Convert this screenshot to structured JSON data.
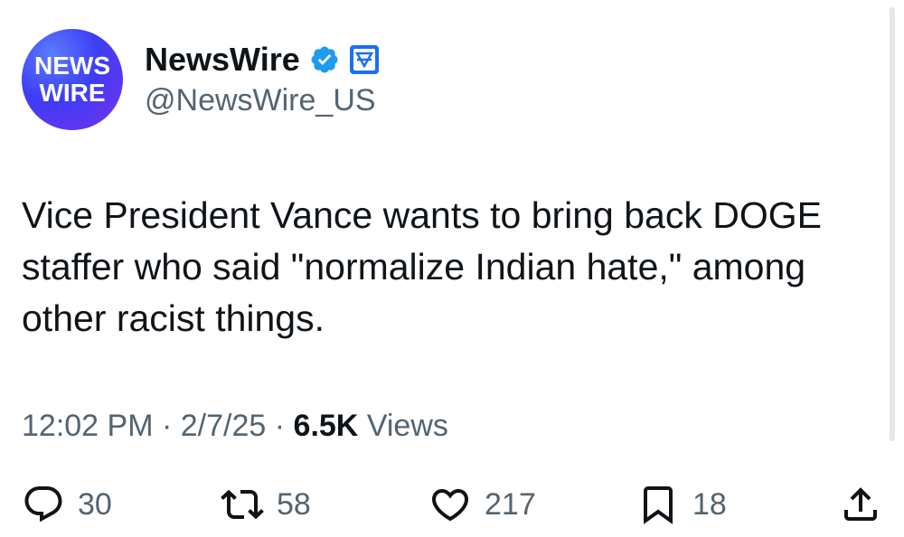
{
  "account": {
    "avatar_line1": "NEWS",
    "avatar_line2": "WIRE",
    "display_name": "NewsWire",
    "handle": "@NewsWire_US",
    "verified_icon": "verified-badge-icon",
    "affiliation_icon": "affiliate-badge-icon"
  },
  "tweet": {
    "text": "Vice President Vance wants to bring back DOGE staffer who said \"normalize Indian hate,\" among other racist things.",
    "time": "12:02 PM",
    "separator": "·",
    "date": "2/7/25",
    "views_count": "6.5K",
    "views_label": "Views"
  },
  "actions": {
    "replies": "30",
    "reposts": "58",
    "likes": "217",
    "bookmarks": "18"
  },
  "colors": {
    "text": "#0f1419",
    "secondary": "#536471",
    "verified": "#1d9bf0"
  }
}
